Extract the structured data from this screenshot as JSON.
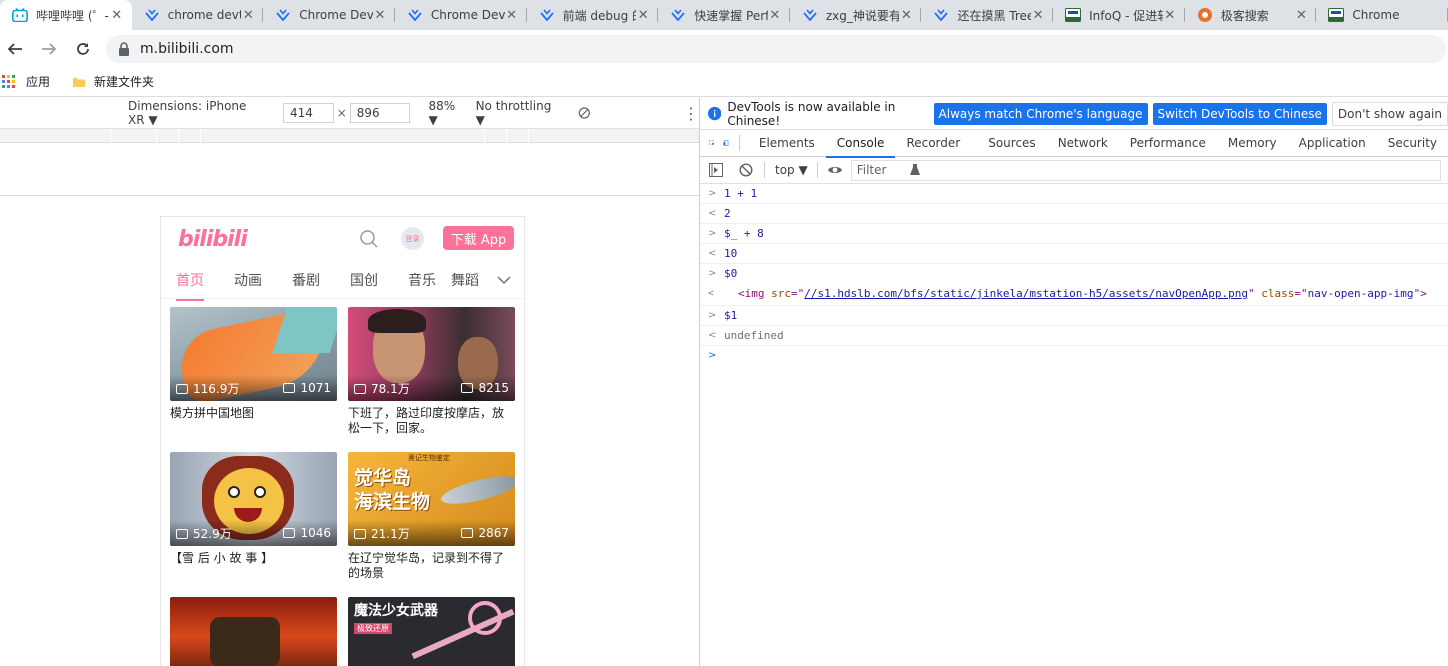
{
  "browser": {
    "tabs": [
      {
        "title": "哔哩哔哩 (゜-",
        "icon": "bilibili-icon",
        "active": true
      },
      {
        "title": "chrome devt",
        "icon": "yuque-icon"
      },
      {
        "title": "Chrome Dev",
        "icon": "yuque-icon"
      },
      {
        "title": "Chrome Dev",
        "icon": "yuque-icon"
      },
      {
        "title": "前端 debug 的",
        "icon": "yuque-icon"
      },
      {
        "title": "快速掌握 Perf",
        "icon": "yuque-icon"
      },
      {
        "title": "zxg_神说要有",
        "icon": "yuque-icon"
      },
      {
        "title": "还在摸黑 Tree",
        "icon": "yuque-icon"
      },
      {
        "title": "InfoQ - 促进软",
        "icon": "infoq-icon"
      },
      {
        "title": "极客搜索",
        "icon": "geek-icon"
      },
      {
        "title": "Chrome",
        "icon": "infoq-icon"
      }
    ],
    "close_glyph": "✕",
    "url": "m.bilibili.com",
    "bookmarks": [
      {
        "label": "应用",
        "icon": "apps-grid-icon"
      },
      {
        "label": "新建文件夹",
        "icon": "folder-icon"
      }
    ]
  },
  "device_toolbar": {
    "dimensions_label": "Dimensions: iPhone XR ▼",
    "width": "414",
    "times": "×",
    "height": "896",
    "zoom": "88% ▼",
    "throttling": "No throttling ▼"
  },
  "bilibili": {
    "logo": "bilibili",
    "login": "登录",
    "download": "下载 App",
    "nav": [
      "首页",
      "动画",
      "番剧",
      "国创",
      "音乐",
      "舞蹈"
    ],
    "videos": [
      {
        "views": "116.9万",
        "danmaku": "1071",
        "title": "模方拼中国地图"
      },
      {
        "views": "78.1万",
        "danmaku": "8215",
        "title": "下班了，路过印度按摩店，放松一下，回家。"
      },
      {
        "views": "52.9万",
        "danmaku": "1046",
        "title": "【雪 后 小 故 事 】"
      },
      {
        "views": "21.1万",
        "danmaku": "2867",
        "title": "在辽宁觉华岛，记录到不得了的场景",
        "overlay_top": "奥记生物鉴定",
        "overlay": "觉华岛\n海滨生物"
      },
      {
        "views": "",
        "danmaku": "",
        "title": ""
      },
      {
        "views": "",
        "danmaku": "",
        "title": "",
        "overlay": "魔法少女武器",
        "overlay_sub": "极致还原"
      }
    ]
  },
  "devtools": {
    "info_text": "DevTools is now available in Chinese!",
    "btn_match": "Always match Chrome's language",
    "btn_switch": "Switch DevTools to Chinese",
    "btn_dismiss": "Don't show again",
    "tabs": [
      "Elements",
      "Console",
      "Recorder",
      "Sources",
      "Network",
      "Performance",
      "Memory",
      "Application",
      "Security"
    ],
    "active_tab": "Console",
    "context": "top ▼",
    "filter_placeholder": "Filter",
    "console": [
      {
        "kind": "in",
        "prompt": ">",
        "text": "1 + 1"
      },
      {
        "kind": "out",
        "prompt": "<",
        "text": "2"
      },
      {
        "kind": "in",
        "prompt": ">",
        "text": "$_ + 8"
      },
      {
        "kind": "out",
        "prompt": "<",
        "text": "10"
      },
      {
        "kind": "in",
        "prompt": ">",
        "text": "$0"
      },
      {
        "kind": "in",
        "prompt": ">",
        "text": "$1"
      },
      {
        "kind": "undef",
        "prompt": "<",
        "text": "undefined"
      }
    ],
    "element_line": {
      "tag_open": "<img",
      "src_attr": "src",
      "src_val": "//s1.hdslb.com/bfs/static/jinkela/mstation-h5/assets/navOpenApp.png",
      "class_attr": "class",
      "class_val": "nav-open-app-img",
      "tag_close": ">"
    }
  }
}
